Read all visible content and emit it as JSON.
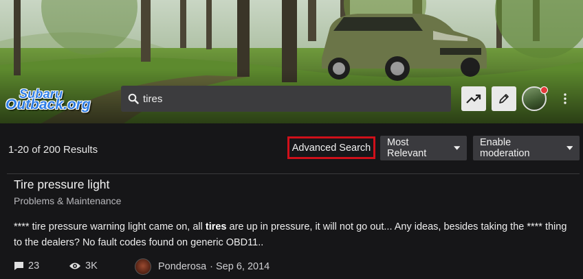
{
  "header": {
    "logo_line1": "Subaru",
    "logo_line2": "Outback.org",
    "search_value": "tires",
    "icons": [
      "search-icon",
      "trending-icon",
      "pencil-icon",
      "avatar",
      "more-vert-icon"
    ]
  },
  "toolbar": {
    "results_count": "1-20 of 200 Results",
    "advanced_search_label": "Advanced Search",
    "sort_label": "Most Relevant",
    "moderation_label": "Enable moderation"
  },
  "results": [
    {
      "title": "Tire pressure light",
      "forum": "Problems & Maintenance",
      "snippet_before": "**** tire pressure warning light came on, all ",
      "snippet_bold": "tires",
      "snippet_after": " are up in pressure, it will not go out... Any ideas, besides taking the **** thing to the dealers? No fault codes found on generic OBD11..",
      "replies": "23",
      "views": "3K",
      "author": "Ponderosa",
      "date": "· Sep 6, 2014"
    }
  ],
  "colors": {
    "background": "#161618",
    "highlight_border": "#d0101a",
    "logo_blue": "#2f7ee6",
    "notification": "#e23a3a"
  }
}
